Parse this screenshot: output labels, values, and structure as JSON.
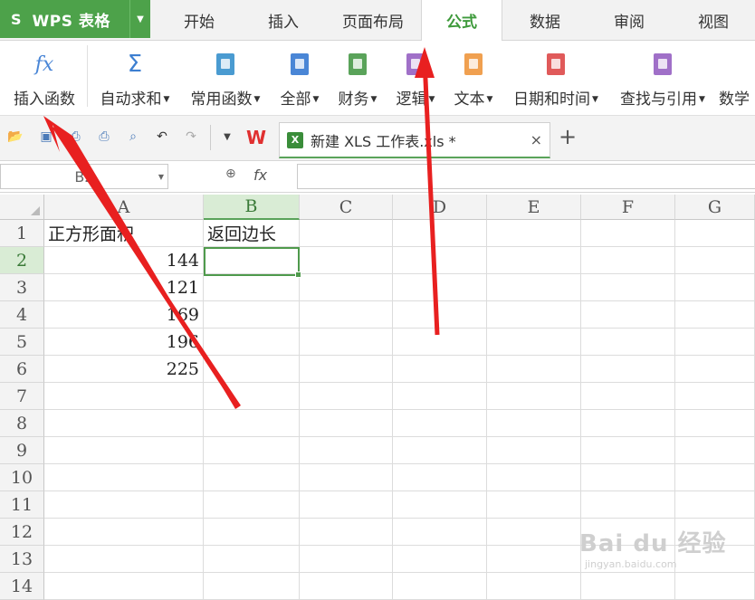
{
  "app": {
    "logo_glyph": "S",
    "title": "WPS 表格",
    "menu_arrow": "▼"
  },
  "tabs": [
    {
      "label": "开始"
    },
    {
      "label": "插入"
    },
    {
      "label": "页面布局"
    },
    {
      "label": "公式",
      "active": true
    },
    {
      "label": "数据"
    },
    {
      "label": "审阅"
    },
    {
      "label": "视图"
    }
  ],
  "ribbon": {
    "insert_function": {
      "icon_text": "fx",
      "label": "插入函数"
    },
    "buttons": [
      {
        "label": "自动求和",
        "icon": "sigma-icon",
        "color": "#3d7fd1"
      },
      {
        "label": "常用函数",
        "icon": "star-book-icon",
        "color": "#4a9bd1"
      },
      {
        "label": "全部",
        "icon": "list-book-icon",
        "color": "#4a86d6"
      },
      {
        "label": "财务",
        "icon": "finance-book-icon",
        "color": "#5aa35a"
      },
      {
        "label": "逻辑",
        "icon": "logic-book-icon",
        "color": "#a070c8"
      },
      {
        "label": "文本",
        "icon": "text-book-icon",
        "color": "#f0a050"
      },
      {
        "label": "日期和时间",
        "icon": "clock-book-icon",
        "color": "#e05a5a"
      },
      {
        "label": "查找与引用",
        "icon": "search-book-icon",
        "color": "#a070c8"
      },
      {
        "label": "数学"
      }
    ]
  },
  "quick_toolbar": {
    "wps_logo": "W",
    "add_tab": "+"
  },
  "document_tab": {
    "icon_text": "X",
    "name": "新建 XLS 工作表.xls *",
    "close": "×"
  },
  "formula_bar": {
    "name_box": "B2",
    "fx": "fx",
    "value": ""
  },
  "sheet": {
    "columns": [
      "A",
      "B",
      "C",
      "D",
      "E",
      "F",
      "G"
    ],
    "rows": [
      "1",
      "2",
      "3",
      "4",
      "5",
      "6",
      "7",
      "8",
      "9",
      "10",
      "11",
      "12",
      "13",
      "14"
    ],
    "cells": {
      "A1": "正方形面积",
      "B1": "返回边长",
      "A2": "144",
      "A3": "121",
      "A4": "169",
      "A5": "196",
      "A6": "225"
    },
    "selected_cell": "B2"
  },
  "watermark": {
    "brand": "Bai du 经验",
    "url": "jingyan.baidu.com"
  },
  "colors": {
    "brand_green": "#4da24a",
    "arrow_red": "#e02020",
    "selection": "#4f9a4c"
  }
}
